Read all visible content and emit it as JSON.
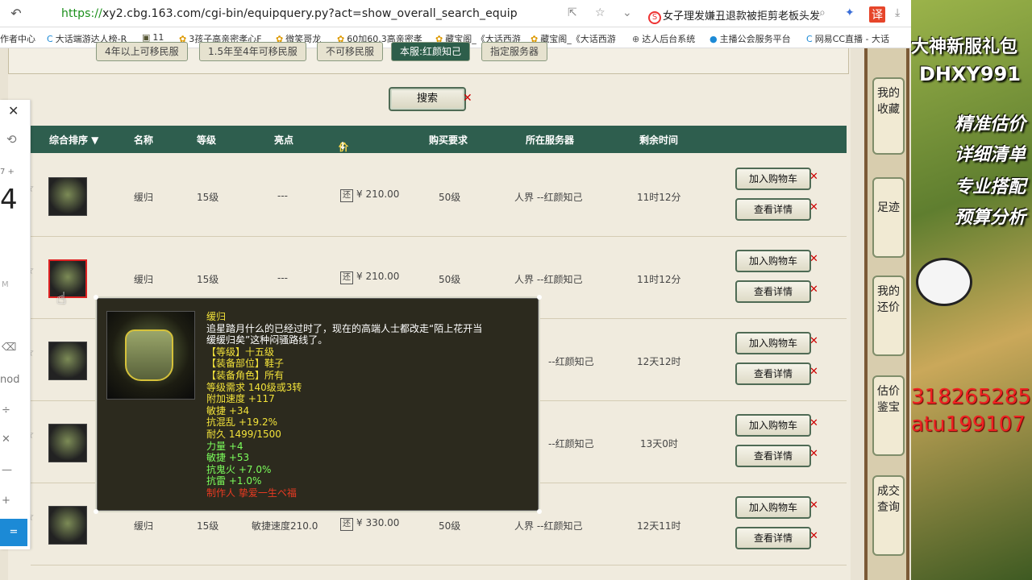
{
  "browser": {
    "url_protocol": "https://",
    "url_rest": "xy2.cbg.163.com/cgi-bin/equipquery.py?act=show_overall_search_equip",
    "news_text": "女子理发嫌丑退款被拒剪老板头发",
    "bookmarks": [
      "作者中心",
      "大话端游达人榜-R",
      "11",
      "3孩子高亲密孝心F",
      "微笑哥龙",
      "60加60.3高亲密孝",
      "藏宝阁_《大话西游",
      "藏宝阁_《大话西游",
      "达人后台系统",
      "主播公会服务平台",
      "网易CC直播 - 大话"
    ]
  },
  "mini_panel": {
    "big_number": "4",
    "small_top": "7 +",
    "mod_text": "nod",
    "m_text": "M"
  },
  "filters": [
    "4年以上可移民服",
    "1.5年至4年可移民服",
    "不可移民服",
    "本服:红颜知己",
    "指定服务器"
  ],
  "search_label": "搜索",
  "table_headers": {
    "sort": "综合排序 ▼",
    "name": "名称",
    "level": "等级",
    "highlight": "亮点",
    "price": "价格(元)",
    "requirement": "购买要求",
    "server": "所在服务器",
    "remaining": "剩余时间"
  },
  "rows": [
    {
      "name": "缓归",
      "level": "15级",
      "highlight": "---",
      "price": "¥ 210.00",
      "req": "50级",
      "server": "人界 --红颜知己",
      "time": "11时12分"
    },
    {
      "name": "缓归",
      "level": "15级",
      "highlight": "---",
      "price": "¥ 210.00",
      "req": "50级",
      "server": "人界 --红颜知己",
      "time": "11时12分"
    },
    {
      "name": "",
      "level": "",
      "highlight": "",
      "price": "",
      "req": "",
      "server": "--红颜知己",
      "time": "12天12时"
    },
    {
      "name": "",
      "level": "",
      "highlight": "",
      "price": "",
      "req": "",
      "server": "--红颜知己",
      "time": "13天0时"
    },
    {
      "name": "缓归",
      "level": "15级",
      "highlight": "敏捷速度210.0",
      "price": "¥ 330.00",
      "req": "50级",
      "server": "人界 --红颜知己",
      "time": "12天11时"
    }
  ],
  "price_tag": "还",
  "row_buttons": {
    "cart": "加入购物车",
    "detail": "查看详情"
  },
  "tooltip": {
    "title": "缓归",
    "desc1": "追星踏月什么的已经过时了，现在的高端人士都改走“陌上花开当",
    "desc2": "缓缓归矣”这种闷骚路线了。",
    "level": "【等级】十五级",
    "part": "【装备部位】鞋子",
    "role": "【装备角色】所有",
    "requirement": "等级需求 140级或3转",
    "speed": "附加速度 +117",
    "agility1": "敏捷 +34",
    "anti_chaos": "抗混乱 +19.2%",
    "durability": "耐久 1499/1500",
    "strength": "力量 +4",
    "agility2": "敏捷 +53",
    "anti_ghost_fire": "抗鬼火 +7.0%",
    "anti_thunder": "抗雷 +1.0%",
    "maker": "制作人 挚爱一生ペ福"
  },
  "right_tabs": [
    "我的收藏",
    "足迹",
    "我的还价",
    "估价鉴宝",
    "成交查询"
  ],
  "ad": {
    "line1": "大神新服礼包",
    "line2": "DHXY991",
    "line3": "精准估价",
    "line4": "详细清单",
    "line5": "专业搭配",
    "line6": "预算分析",
    "red1": "318265285",
    "red2": "atu199107"
  }
}
